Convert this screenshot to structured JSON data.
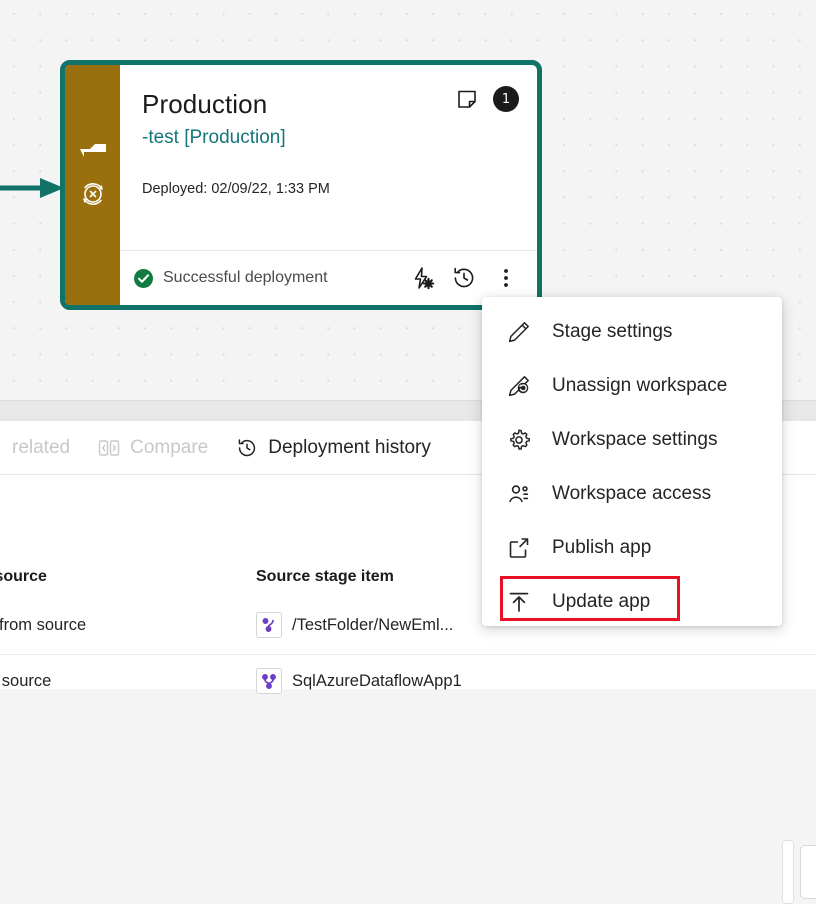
{
  "colors": {
    "teal_border": "#0f7368",
    "gold_rail": "#9a700f",
    "link_teal": "#13767d",
    "status_green": "#107c41",
    "highlight_red": "#e81123",
    "canvas_bg": "#f4f4f4"
  },
  "card": {
    "stage_title": "Production",
    "workspace_link": "-test [Production]",
    "deployed_label": "Deployed:  02/09/22, 1:33 PM",
    "item_count_badge": "1",
    "status_text": "Successful deployment",
    "note_icon": "note-icon",
    "rail_icons": [
      "stage-marker-icon",
      "blocked-deploy-icon"
    ],
    "footer_icons": [
      "deployment-rules-icon",
      "deployment-history-icon",
      "more-options-icon"
    ]
  },
  "context_menu": {
    "items": [
      {
        "label": "Stage settings",
        "icon": "pencil-icon"
      },
      {
        "label": "Unassign workspace",
        "icon": "pencil-undo-icon"
      },
      {
        "label": "Workspace settings",
        "icon": "gear-icon"
      },
      {
        "label": "Workspace access",
        "icon": "people-icon"
      },
      {
        "label": "Publish app",
        "icon": "external-link-icon"
      },
      {
        "label": "Update app",
        "icon": "upload-icon"
      }
    ],
    "highlighted_item": "Update app"
  },
  "tabs": [
    {
      "label": "related",
      "icon": "related-icon",
      "disabled": true
    },
    {
      "label": "Compare",
      "icon": "compare-icon",
      "disabled": true
    },
    {
      "label": "Deployment history",
      "icon": "deployment-history-icon",
      "disabled": false
    }
  ],
  "table": {
    "headers": {
      "compare": "l to source",
      "source": "Source stage item"
    },
    "rows": [
      {
        "compare_text": "rent from source",
        "item_name": "/TestFolder/NewEml...",
        "item_icon": "dataflow-icon"
      },
      {
        "compare_text": "e as source",
        "item_name": "SqlAzureDataflowApp1",
        "item_icon": "dataflow-multi-icon"
      }
    ]
  }
}
